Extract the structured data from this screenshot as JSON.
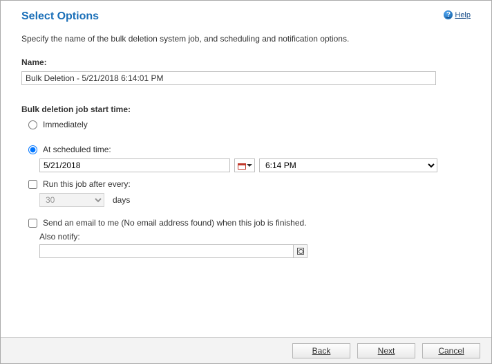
{
  "header": {
    "title": "Select Options",
    "help_label": "Help"
  },
  "description": "Specify the name of the bulk deletion system job, and scheduling and notification options.",
  "name_field": {
    "label": "Name:",
    "value": "Bulk Deletion - 5/21/2018 6:14:01 PM"
  },
  "start_time": {
    "section_label": "Bulk deletion job start time:",
    "immediately_label": "Immediately",
    "scheduled_label": "At scheduled time:",
    "selected": "scheduled",
    "date_value": "5/21/2018",
    "time_value": "6:14 PM"
  },
  "recurrence": {
    "label": "Run this job after every:",
    "value": "30",
    "suffix": "days"
  },
  "notify": {
    "email_label": "Send an email to me (No email address found) when this job is finished.",
    "also_label": "Also notify:",
    "lookup_value": ""
  },
  "footer": {
    "back": "Back",
    "next": "Next",
    "cancel": "Cancel"
  }
}
